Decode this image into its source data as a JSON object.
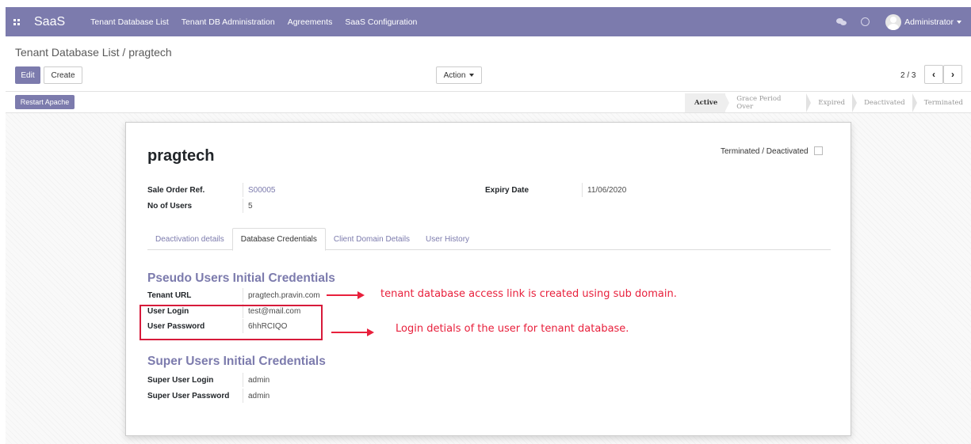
{
  "navbar": {
    "brand": "SaaS",
    "menu": [
      "Tenant Database List",
      "Tenant DB Administration",
      "Agreements",
      "SaaS Configuration"
    ],
    "user": "Administrator",
    "color": "#7c7bad"
  },
  "control_panel": {
    "breadcrumb": "Tenant Database List / pragtech",
    "edit_label": "Edit",
    "create_label": "Create",
    "action_label": "Action",
    "pager": "2 / 3",
    "prev_icon": "chevron-left-icon",
    "next_icon": "chevron-right-icon"
  },
  "header": {
    "restart_label": "Restart Apache",
    "stages": [
      "Active",
      "Grace Period Over",
      "Expired",
      "Deactivated",
      "Terminated"
    ],
    "active_stage": "Active"
  },
  "record": {
    "name": "pragtech",
    "terminated_label": "Terminated / Deactivated",
    "terminated_checked": false,
    "sale_order_label": "Sale Order Ref.",
    "sale_order_value": "S00005",
    "users_label": "No of Users",
    "users_value": "5",
    "expiry_label": "Expiry Date",
    "expiry_value": "11/06/2020"
  },
  "tabs": [
    "Deactivation details",
    "Database Credentials",
    "Client Domain Details",
    "User History"
  ],
  "active_tab": "Database Credentials",
  "pseudo": {
    "title": "Pseudo Users Initial Credentials",
    "url_label": "Tenant URL",
    "url_value": "pragtech.pravin.com",
    "login_label": "User Login",
    "login_value": "test@mail.com",
    "password_label": "User Password",
    "password_value": "6hhRCIQO"
  },
  "super": {
    "title": "Super Users Initial Credentials",
    "login_label": "Super User Login",
    "login_value": "admin",
    "password_label": "Super User Password",
    "password_value": "admin"
  },
  "annotations": {
    "note1": "tenant database access link is created using sub domain.",
    "note2": "Login detials of the user for tenant database.",
    "color": "#e8203c"
  }
}
